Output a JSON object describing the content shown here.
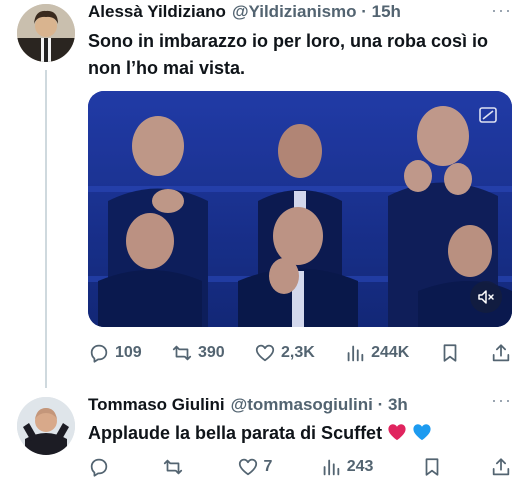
{
  "tweets": [
    {
      "author": "Alessà Yildiziano",
      "handle": "@Yildizianismo",
      "time": "15h",
      "more": "···",
      "text": "Sono in imbarazzo io per loro, una roba così io non l’ho mai vista.",
      "media": {
        "type": "video",
        "muted": true
      },
      "metrics": {
        "replies": "109",
        "retweets": "390",
        "likes": "2,3K",
        "views": "244K"
      }
    },
    {
      "author": "Tommaso Giulini",
      "handle": "@tommasogiulini",
      "time": "3h",
      "more": "···",
      "text": "Applaude la bella parata di Scuffet",
      "emojis": [
        "❤️",
        "💙"
      ],
      "metrics": {
        "replies": "",
        "retweets": "",
        "likes": "7",
        "views": "243"
      }
    }
  ],
  "colors": {
    "icon": "#536471",
    "text": "#0f1419",
    "media_bg": "#1b2f8f",
    "heart_red": "#e0245e",
    "heart_blue": "#1d9bf0"
  }
}
